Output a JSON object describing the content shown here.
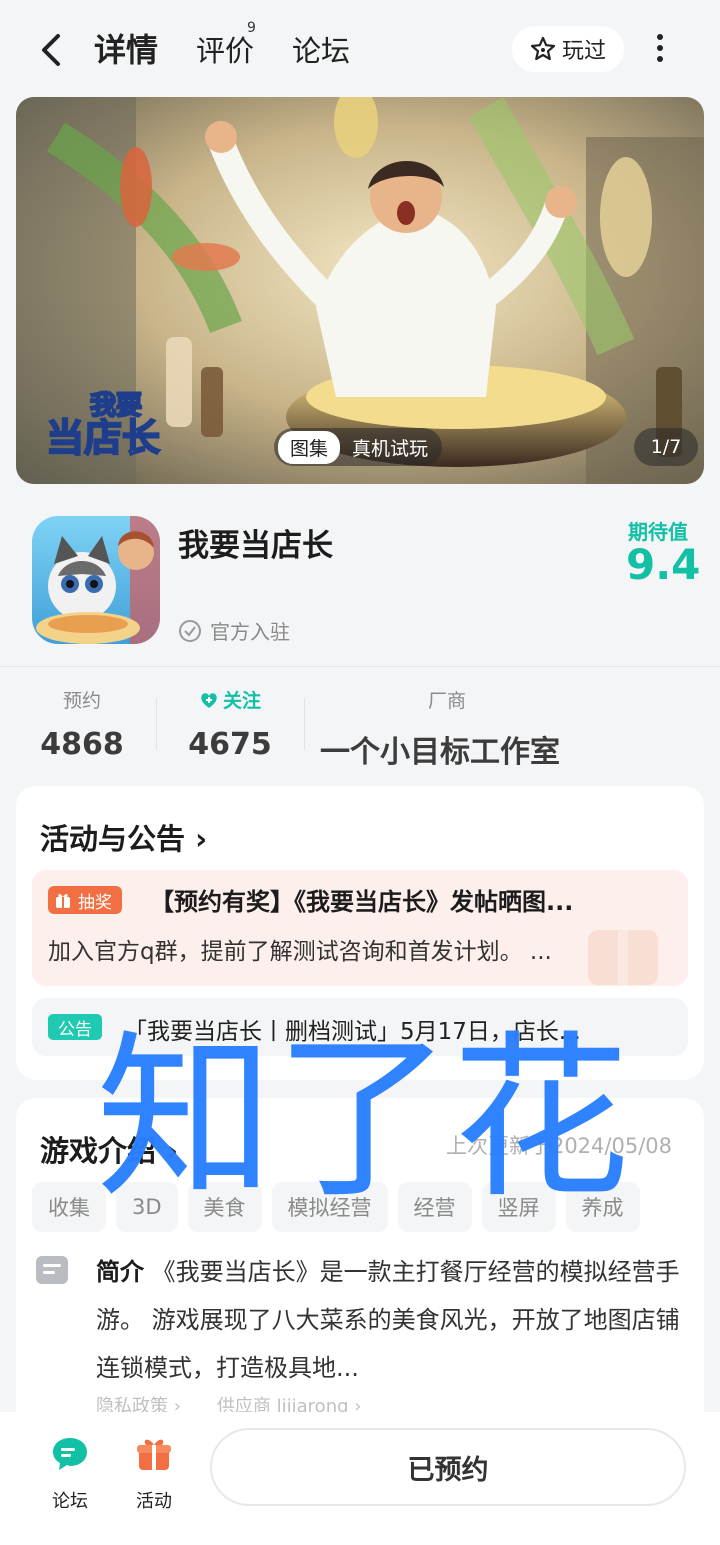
{
  "nav": {
    "tabs": [
      {
        "label": "详情"
      },
      {
        "label": "评价",
        "badge": "9"
      },
      {
        "label": "论坛"
      }
    ],
    "played_label": "玩过",
    "icons": [
      "back-arrow-icon",
      "star-icon",
      "more-vertical-icon"
    ]
  },
  "banner": {
    "logo_line1": "我要",
    "logo_line2": "当店长",
    "gallery_label": "图集",
    "trial_label": "真机试玩",
    "page_counter": "1/7"
  },
  "app": {
    "name": "我要当店长",
    "official_label": "官方入驻",
    "expect_label": "期待值",
    "expect_value": "9.4"
  },
  "stats": {
    "reserve": {
      "label": "预约",
      "value": "4868"
    },
    "follow": {
      "label": "关注",
      "value": "4675"
    },
    "developer": {
      "label": "厂商",
      "value": "一个小目标工作室"
    }
  },
  "announcements": {
    "title": "活动与公告",
    "items": [
      {
        "tag": "抽奖",
        "title": "【预约有奖】《我要当店长》发帖晒图...",
        "subtitle": "加入官方q群，提前了解测试咨询和首发计划。 ..."
      },
      {
        "tag": "公告",
        "title": "「我要当店长丨删档测试」5月17日，店长..."
      }
    ]
  },
  "intro": {
    "title": "游戏介绍",
    "updated": "上次更新于2024/05/08",
    "tags": [
      "收集",
      "3D",
      "美食",
      "模拟经营",
      "经营",
      "竖屏",
      "养成"
    ],
    "summary_label": "简介",
    "summary": "《我要当店长》是一款主打餐厅经营的模拟经营手游。 游戏展现了八大菜系的美食风光，开放了地图店铺连锁模式，打造极具地...",
    "privacy_link": "隐私政策",
    "supplier_link": "供应商 lijiarong"
  },
  "watermark": "知了花",
  "bottom": {
    "forum_label": "论坛",
    "activity_label": "活动",
    "reserve_button": "已预约"
  },
  "colors": {
    "accent": "#12c0a6",
    "lottery": "#f26f43",
    "watermark": "#2a7fff",
    "background": "#f4f5f6"
  }
}
